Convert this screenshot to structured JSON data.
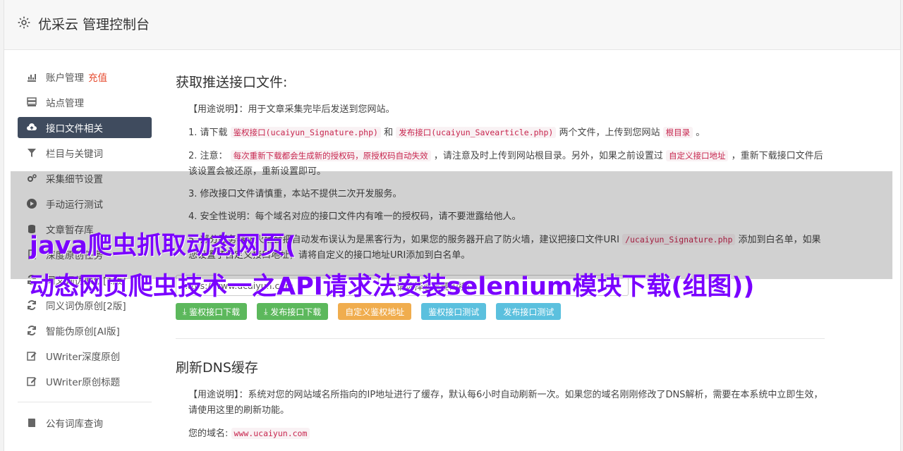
{
  "header": {
    "title": "优采云 管理控制台"
  },
  "sidebar": {
    "items": [
      {
        "label": "账户管理",
        "badge": "充值",
        "icon": "bar-chart-icon"
      },
      {
        "label": "站点管理",
        "icon": "server-icon"
      },
      {
        "label": "接口文件相关",
        "icon": "cloud-upload-icon",
        "active": true
      },
      {
        "label": "栏目与关键词",
        "icon": "filter-icon"
      },
      {
        "label": "采集细节设置",
        "icon": "gears-icon"
      },
      {
        "label": "手动运行测试",
        "icon": "play-circle-icon"
      },
      {
        "label": "文章暂存库",
        "icon": "database-icon"
      },
      {
        "label": "深度原创任务",
        "icon": "file-icon"
      },
      {
        "label": "同义词伪原创[1版]",
        "icon": "refresh-icon"
      },
      {
        "label": "同义词伪原创[2版]",
        "icon": "refresh-icon"
      },
      {
        "label": "智能伪原创[AI版]",
        "icon": "refresh-icon"
      },
      {
        "label": "UWriter深度原创",
        "icon": "edit-icon"
      },
      {
        "label": "UWriter原创标题",
        "icon": "edit-icon"
      },
      {
        "label": "公有词库查询",
        "icon": "book-icon"
      }
    ]
  },
  "section1": {
    "title": "获取推送接口文件:",
    "usage_label": "【用途说明】：用于文章采集完毕后发送到您网站。",
    "step1_a": "1. 请下载",
    "step1_code1": "鉴权接口(ucaiyun_Signature.php)",
    "step1_b": "和",
    "step1_code2": "发布接口(ucaiyun_Savearticle.php)",
    "step1_c": "两个文件，上传到您网站",
    "step1_code3": "根目录",
    "step1_d": "。",
    "step2_a": "2. 注意：",
    "step2_code1": "每次重新下载都会生成新的授权码，原授权码自动失效",
    "step2_b": "，请注意及时上传到网站根目录。另外，如果之前设置过",
    "step2_code2": "自定义接口地址",
    "step2_c": "，重新下载接口文件后该设置会被还原，重新设置即可。",
    "step3": "3. 修改接口文件请慎重，本站不提供二次开发服务。",
    "step4": "4. 安全性说明：每个域名对应的接口文件内有唯一的授权码，请不要泄露给他人。",
    "step5_a": "5. 部分服务器防火墙会把自动发布误认为是黑客行为，如果您的服务器开启了防火墙，建议把接口文件URI",
    "step5_code": "/ucaiyun_Signature.php",
    "step5_b": "添加到白名单，如果您设置了自定义接口地址，请将自定义的接口地址URI添加到白名单。",
    "input1": "https://www.ucaiyun.com",
    "input2_placeholder": "请选择您需要的接口",
    "btn1": "鉴权接口下载",
    "btn2": "发布接口下载",
    "btn3": "自定义鉴权地址",
    "btn4": "鉴权接口测试",
    "btn5": "发布接口测试"
  },
  "section2": {
    "title": "刷新DNS缓存",
    "usage": "【用途说明】：系统对您的网站域名所指向的IP地址进行了缓存，默认每6小时自动刷新一次。如果您的域名刚刚修改了DNS解析，需要在本系统中立即生效，请使用这里的刷新功能。",
    "domain_label": "您的域名:",
    "domain_value": "www.ucaiyun.com"
  },
  "overlay": {
    "line1": "java爬虫抓取动态网页(",
    "line2": "动态网页爬虫技术一之API请求法安装selenium模块下载(组图))"
  },
  "colors": {
    "active_bg": "#3f4b5e",
    "green": "#5cb85c",
    "orange": "#f0ad4e",
    "blue": "#5bc0de",
    "overlay_text": "#7a00ff"
  }
}
